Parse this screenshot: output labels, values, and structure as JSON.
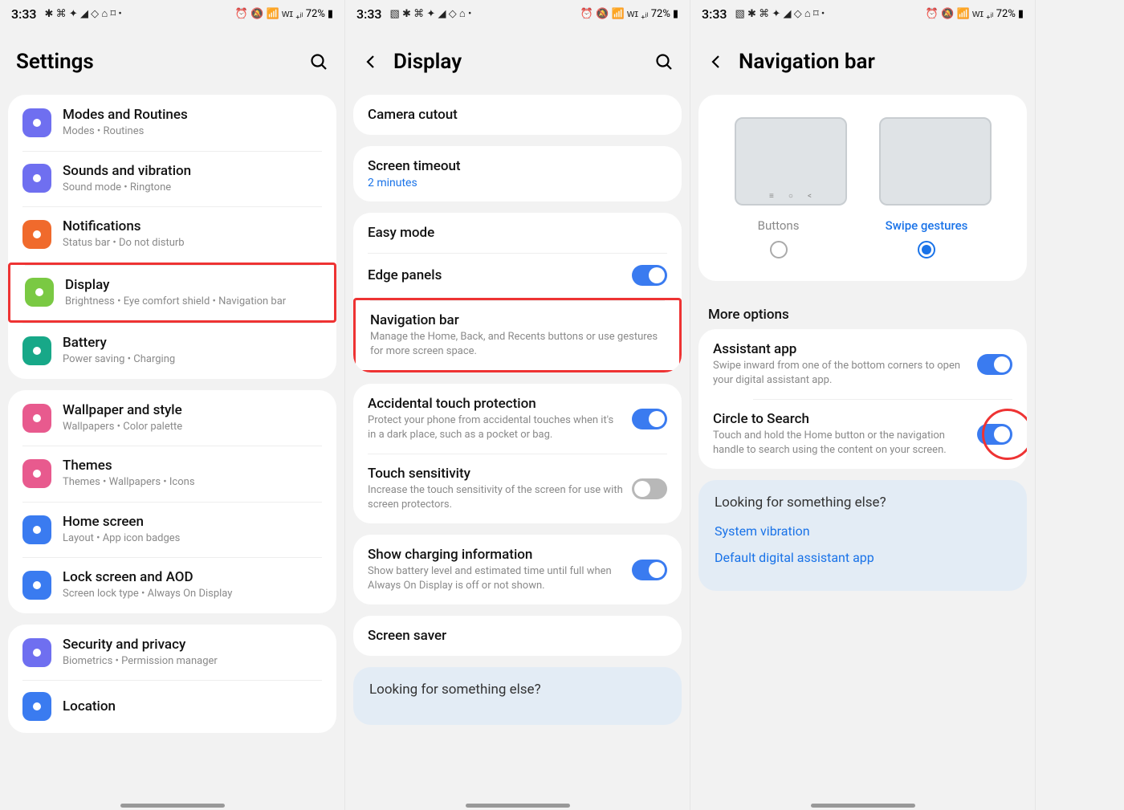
{
  "status": {
    "time": "3:33",
    "battery": "72%",
    "icons_left_a": "✱ ⌘ ✦ ◢ ◇ ⌂ ⌑ •",
    "icons_left_b": "▧ ✱ ⌘ ✦ ◢ ◇ ⌂ •",
    "icons_left_c": "▧ ✱ ⌘ ✦ ◢ ◇ ⌂ ⌑ •",
    "icons_right": "⏰ 🔕 📶 ᴡɪ ₊ᵢₗ"
  },
  "screen1": {
    "title": "Settings",
    "items": [
      {
        "title": "Modes and Routines",
        "sub": "Modes  •  Routines",
        "color": "#6f6ff0",
        "icon": "routines-icon"
      },
      {
        "title": "Sounds and vibration",
        "sub": "Sound mode  •  Ringtone",
        "color": "#6f6ff0",
        "icon": "sound-icon"
      },
      {
        "title": "Notifications",
        "sub": "Status bar  •  Do not disturb",
        "color": "#f06a2c",
        "icon": "notifications-icon"
      },
      {
        "title": "Display",
        "sub": "Brightness  •  Eye comfort shield  •  Navigation bar",
        "color": "#7ac943",
        "icon": "display-icon",
        "hl": true
      },
      {
        "title": "Battery",
        "sub": "Power saving  •  Charging",
        "color": "#17a888",
        "icon": "battery-icon"
      },
      {
        "title": "Wallpaper and style",
        "sub": "Wallpapers  •  Color palette",
        "color": "#e85a8e",
        "icon": "wallpaper-icon"
      },
      {
        "title": "Themes",
        "sub": "Themes  •  Wallpapers  •  Icons",
        "color": "#e85a8e",
        "icon": "themes-icon"
      },
      {
        "title": "Home screen",
        "sub": "Layout  •  App icon badges",
        "color": "#3a7bf0",
        "icon": "home-icon"
      },
      {
        "title": "Lock screen and AOD",
        "sub": "Screen lock type  •  Always On Display",
        "color": "#3a7bf0",
        "icon": "lock-icon"
      },
      {
        "title": "Security and privacy",
        "sub": "Biometrics  •  Permission manager",
        "color": "#6f6ff0",
        "icon": "security-icon"
      },
      {
        "title": "Location",
        "sub": "",
        "color": "#3a7bf0",
        "icon": "location-icon"
      }
    ]
  },
  "screen2": {
    "title": "Display",
    "group1": [
      {
        "title": "Camera cutout"
      }
    ],
    "group2": [
      {
        "title": "Screen timeout",
        "value": "2 minutes"
      }
    ],
    "group3": [
      {
        "title": "Easy mode"
      },
      {
        "title": "Edge panels",
        "toggle": "on"
      },
      {
        "title": "Navigation bar",
        "sub": "Manage the Home, Back, and Recents buttons or use gestures for more screen space.",
        "hl": true
      }
    ],
    "group4": [
      {
        "title": "Accidental touch protection",
        "sub": "Protect your phone from accidental touches when it's in a dark place, such as a pocket or bag.",
        "toggle": "on"
      },
      {
        "title": "Touch sensitivity",
        "sub": "Increase the touch sensitivity of the screen for use with screen protectors.",
        "toggle": "off"
      }
    ],
    "group5": [
      {
        "title": "Show charging information",
        "sub": "Show battery level and estimated time until full when Always On Display is off or not shown.",
        "toggle": "on"
      }
    ],
    "group6": [
      {
        "title": "Screen saver"
      }
    ],
    "looking": "Looking for something else?"
  },
  "screen3": {
    "title": "Navigation bar",
    "option_a": "Buttons",
    "option_b": "Swipe gestures",
    "more": "More options",
    "items": [
      {
        "title": "Assistant app",
        "sub": "Swipe inward from one of the bottom corners to open your digital assistant app.",
        "toggle": "on"
      },
      {
        "title": "Circle to Search",
        "sub": "Touch and hold the Home button or the navigation handle to search using the content on your screen.",
        "toggle": "on",
        "circle": true
      }
    ],
    "looking": {
      "title": "Looking for something else?",
      "links": [
        "System vibration",
        "Default digital assistant app"
      ]
    }
  }
}
